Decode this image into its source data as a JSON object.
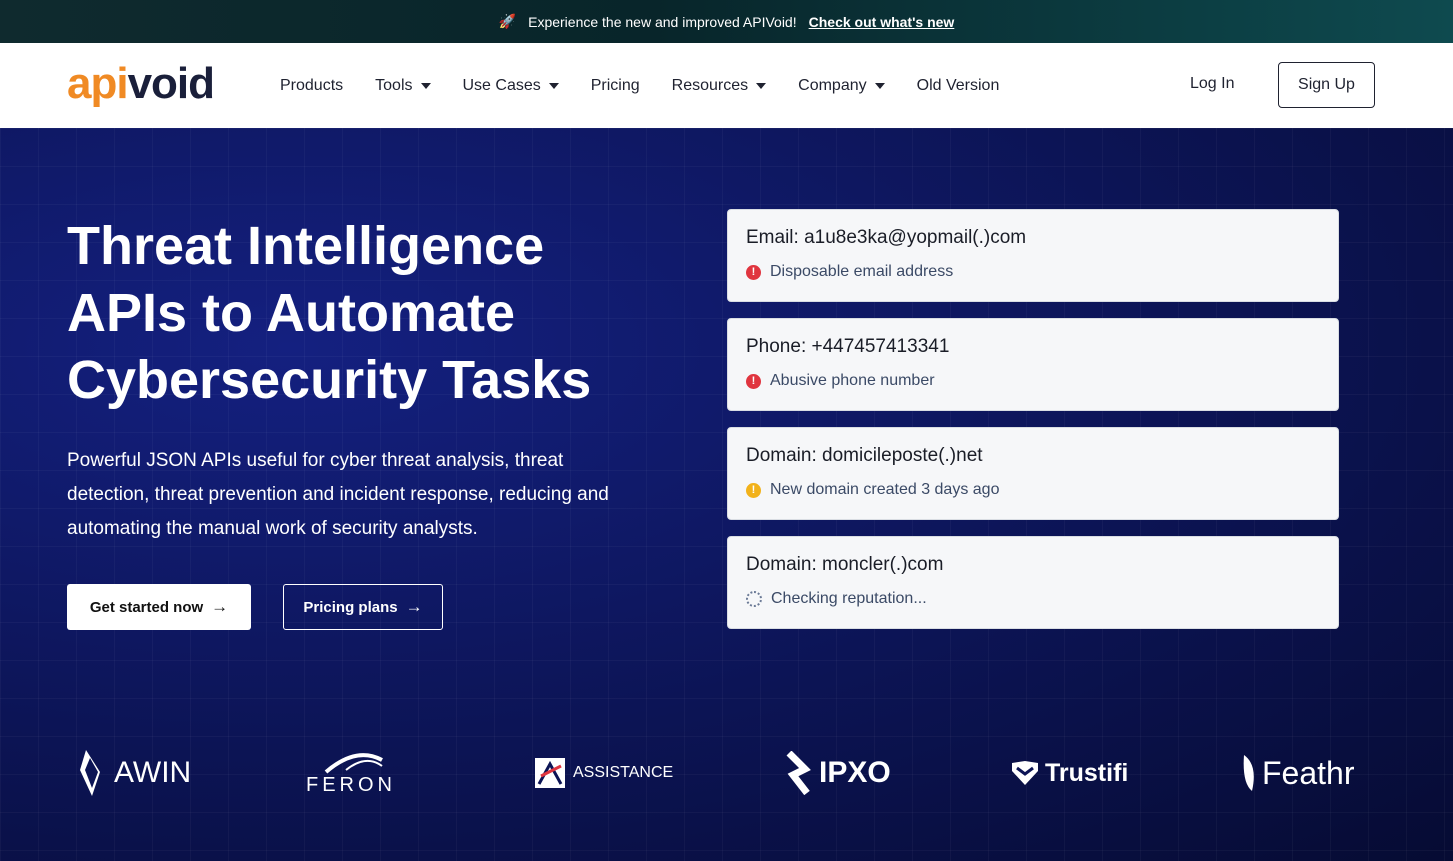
{
  "announcement": {
    "text": "Experience the new and improved APIVoid!",
    "link": "Check out what's new",
    "icon": "rocket-icon"
  },
  "header": {
    "logo": {
      "part1": "api",
      "part2": "void"
    },
    "nav": [
      {
        "label": "Products",
        "dropdown": false
      },
      {
        "label": "Tools",
        "dropdown": true
      },
      {
        "label": "Use Cases",
        "dropdown": true
      },
      {
        "label": "Pricing",
        "dropdown": false
      },
      {
        "label": "Resources",
        "dropdown": true
      },
      {
        "label": "Company",
        "dropdown": true
      },
      {
        "label": "Old Version",
        "dropdown": false
      }
    ],
    "login": "Log In",
    "signup": "Sign Up"
  },
  "hero": {
    "headline_lines": [
      "Threat Intelligence",
      "APIs to Automate",
      "Cybersecurity Tasks"
    ],
    "subtext": "Powerful JSON APIs useful for cyber threat analysis, threat detection, threat prevention and incident response, reducing and automating the manual work of security analysts.",
    "cta_primary": "Get started now",
    "cta_secondary": "Pricing plans"
  },
  "cards": [
    {
      "title": "Email: a1u8e3ka@yopmail(.)com",
      "status": "Disposable email address",
      "level": "red"
    },
    {
      "title": "Phone: +447457413341",
      "status": "Abusive phone number",
      "level": "red"
    },
    {
      "title": "Domain: domicileposte(.)net",
      "status": "New domain created 3 days ago",
      "level": "yellow"
    },
    {
      "title": "Domain: moncler(.)com",
      "status": "Checking reputation...",
      "level": "loading"
    }
  ],
  "clients": [
    "AWIN",
    "FERON",
    "ASSISTANCE",
    "IPXO",
    "Trustifi",
    "Feathr"
  ],
  "colors": {
    "brand_orange": "#f08a24",
    "hero_bg": "#0c1455",
    "alert_red": "#e0353f",
    "alert_yellow": "#f2b21b"
  }
}
